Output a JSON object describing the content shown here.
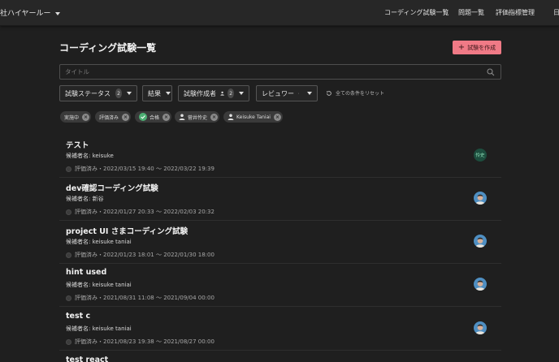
{
  "header": {
    "brand": "社ハイヤールー",
    "nav": [
      "コーディング試験一覧",
      "問題一覧",
      "評価指標管理",
      "日"
    ]
  },
  "page": {
    "title": "コーディング試験一覧",
    "create_label": "試験を作成"
  },
  "search": {
    "placeholder": "タイトル",
    "value": ""
  },
  "filters": {
    "status": {
      "label": "試験ステータス",
      "count": "2"
    },
    "result": {
      "label": "結果"
    },
    "creator": {
      "label": "試験作成者",
      "count": "2"
    },
    "reviewer": {
      "label": "レビュワー"
    },
    "reset_label": "全ての条件をリセット"
  },
  "chips": [
    "実施中",
    "評価済み",
    "合格",
    "菅井怜史",
    "Keisuke Taniai"
  ],
  "tests": [
    {
      "title": "テスト",
      "candidate": "候補者名: keisuke",
      "status": "評価済み・2022/03/15 19:40 〜 2022/03/22 19:39",
      "avatar_text": "怜史"
    },
    {
      "title": "dev確認コーディング試験",
      "candidate": "候補者名: 新谷",
      "status": "評価済み・2022/01/27 20:33 〜 2022/02/03 20:32"
    },
    {
      "title": "project UI さまコーディング試験",
      "candidate": "候補者名: keisuke taniai",
      "status": "評価済み・2022/01/23 18:01 〜 2022/01/30 18:00"
    },
    {
      "title": "hint used",
      "candidate": "候補者名: keisuke taniai",
      "status": "評価済み・2021/08/31 11:08 〜 2021/09/04 00:00"
    },
    {
      "title": "test c",
      "candidate": "候補者名: keisuke taniai",
      "status": "評価済み・2021/08/23 19:38 〜 2021/08/27 00:00"
    },
    {
      "title": "test react"
    }
  ]
}
